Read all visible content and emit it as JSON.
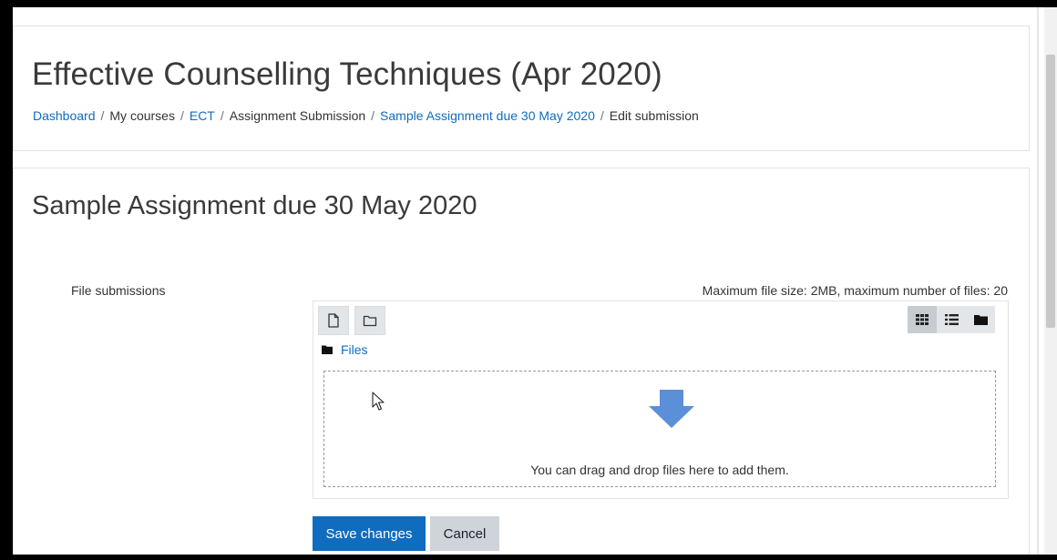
{
  "header": {
    "course_title": "Effective Counselling Techniques (Apr 2020)",
    "breadcrumb": [
      {
        "label": "Dashboard",
        "link": true
      },
      {
        "label": "My courses",
        "link": false
      },
      {
        "label": "ECT",
        "link": true
      },
      {
        "label": "Assignment Submission",
        "link": false
      },
      {
        "label": "Sample Assignment due 30 May 2020",
        "link": true
      },
      {
        "label": "Edit submission",
        "link": false
      }
    ],
    "separator": "/"
  },
  "main": {
    "page_title": "Sample Assignment due 30 May 2020",
    "field_label": "File submissions",
    "file_limits": "Maximum file size: 2MB, maximum number of files: 20",
    "filemanager": {
      "toolbar_icons": [
        "add-file-icon",
        "create-folder-icon"
      ],
      "view_icons": [
        "grid-view-icon",
        "list-view-icon",
        "tree-view-icon"
      ],
      "active_view": "grid-view-icon",
      "path_label": "Files",
      "dropzone_text": "You can drag and drop files here to add them."
    },
    "buttons": {
      "save_label": "Save changes",
      "cancel_label": "Cancel"
    }
  },
  "colors": {
    "accent": "#0f6cbf",
    "drop_arrow": "#5b8fd8",
    "secondary_button": "#ced4da"
  }
}
